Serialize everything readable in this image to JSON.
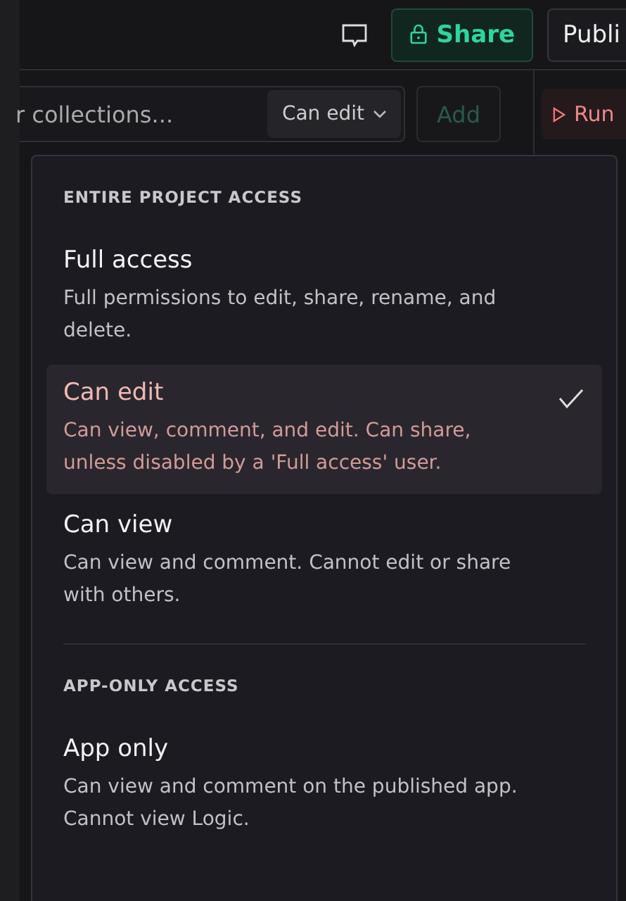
{
  "toolbar": {
    "share_label": "Share",
    "publish_label": "Publi",
    "run_label": "Run"
  },
  "invite": {
    "value": "r collections...",
    "permission": "Can edit",
    "add_label": "Add",
    "add_disabled": true
  },
  "menu": {
    "sections": [
      {
        "heading": "ENTIRE PROJECT ACCESS",
        "options": [
          {
            "title": "Full access",
            "description": "Full permissions to edit, share, rename, and delete.",
            "selected": false
          },
          {
            "title": "Can edit",
            "description": "Can view, comment, and edit. Can share, unless disabled by a 'Full access' user.",
            "selected": true
          },
          {
            "title": "Can view",
            "description": "Can view and comment. Cannot edit or share with others.",
            "selected": false
          }
        ]
      },
      {
        "heading": "APP-ONLY ACCESS",
        "options": [
          {
            "title": "App only",
            "description": "Can view and comment on the published app. Cannot view Logic.",
            "selected": false
          }
        ]
      }
    ]
  }
}
